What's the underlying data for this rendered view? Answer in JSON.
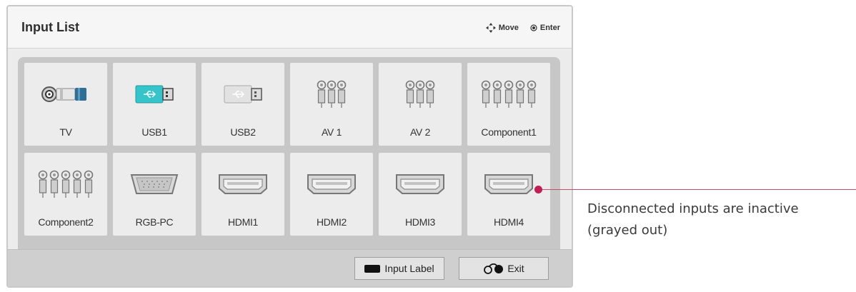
{
  "header": {
    "title": "Input List",
    "hint_move": "Move",
    "hint_enter": "Enter"
  },
  "inputs": [
    {
      "label": "TV",
      "icon": "antenna-connector-icon",
      "active": true
    },
    {
      "label": "USB1",
      "icon": "usb-icon",
      "active": true
    },
    {
      "label": "USB2",
      "icon": "usb-icon",
      "active": false
    },
    {
      "label": "AV 1",
      "icon": "rca-3-connector-icon",
      "active": false
    },
    {
      "label": "AV 2",
      "icon": "rca-3-connector-icon",
      "active": false
    },
    {
      "label": "Component1",
      "icon": "rca-5-connector-icon",
      "active": false
    },
    {
      "label": "Component2",
      "icon": "rca-5-connector-icon",
      "active": false
    },
    {
      "label": "RGB-PC",
      "icon": "vga-connector-icon",
      "active": false
    },
    {
      "label": "HDMI1",
      "icon": "hdmi-connector-icon",
      "active": false
    },
    {
      "label": "HDMI2",
      "icon": "hdmi-connector-icon",
      "active": false
    },
    {
      "label": "HDMI3",
      "icon": "hdmi-connector-icon",
      "active": false
    },
    {
      "label": "HDMI4",
      "icon": "hdmi-connector-icon",
      "active": false
    }
  ],
  "footer": {
    "input_label_button": "Input Label",
    "exit_button": "Exit"
  },
  "callout": {
    "text": "Disconnected inputs are inactive (grayed out)"
  }
}
